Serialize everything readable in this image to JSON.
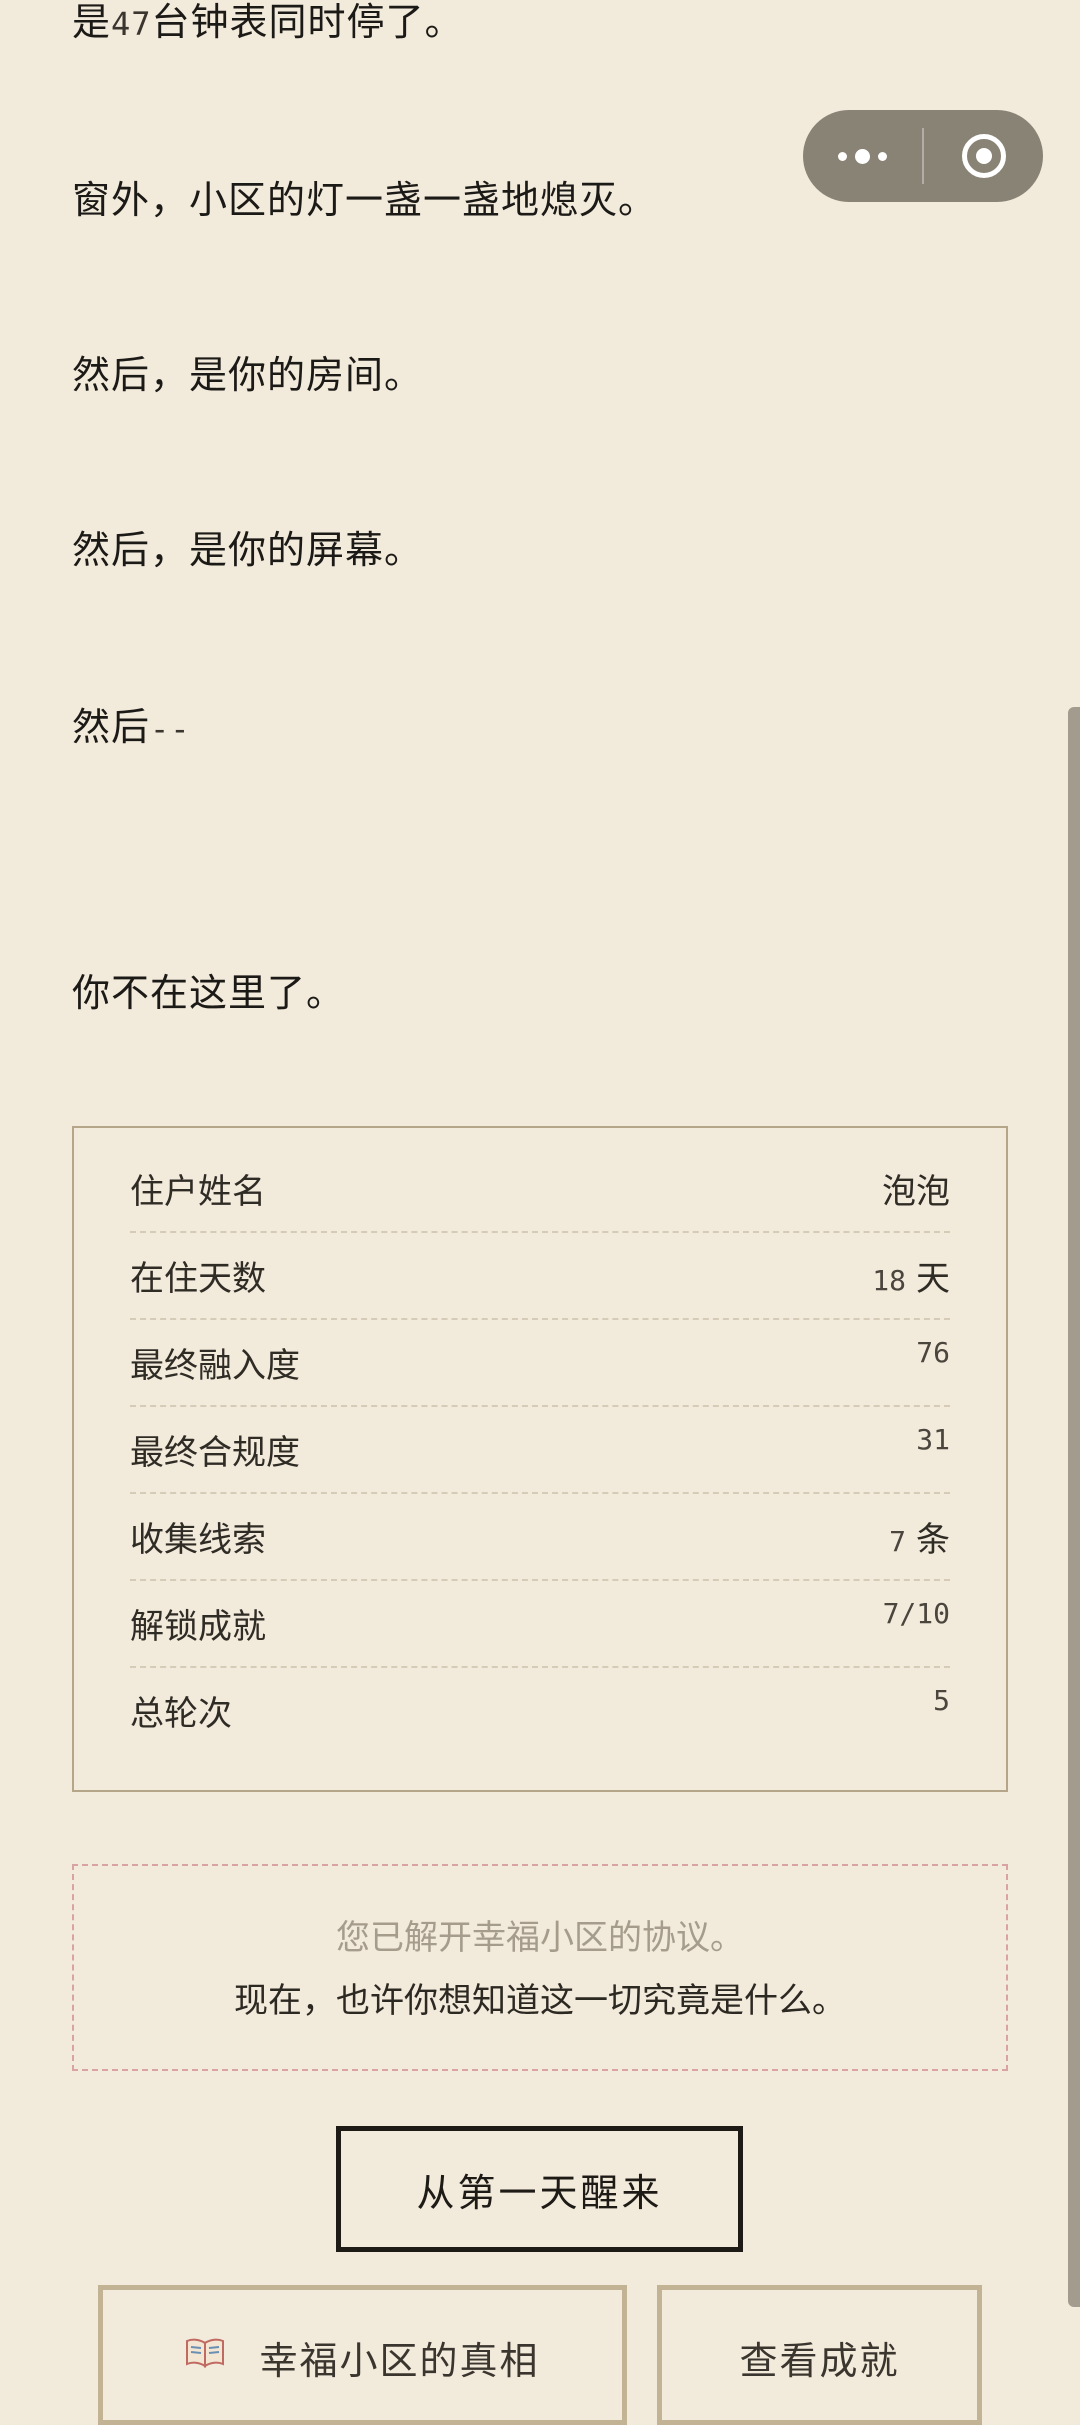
{
  "story": {
    "line1_pre": "是",
    "line1_num": "47",
    "line1_post": "台钟表同时停了。",
    "line2": "窗外，小区的灯一盏一盏地熄灭。",
    "line3": "然后，是你的房间。",
    "line4": "然后，是你的屏幕。",
    "line5_pre": "然后",
    "line5_dash": "--",
    "line6": "你不在这里了。"
  },
  "capsule": {
    "menu_icon": "more-dots-icon",
    "close_icon": "target-circle-icon"
  },
  "stats": [
    {
      "label": "住户姓名",
      "value": "泡泡",
      "unit": ""
    },
    {
      "label": "在住天数",
      "value": "18",
      "unit": "天"
    },
    {
      "label": "最终融入度",
      "value": "76",
      "unit": ""
    },
    {
      "label": "最终合规度",
      "value": "31",
      "unit": ""
    },
    {
      "label": "收集线索",
      "value": "7",
      "unit": "条"
    },
    {
      "label": "解锁成就",
      "value": "7/10",
      "unit": ""
    },
    {
      "label": "总轮次",
      "value": "5",
      "unit": ""
    }
  ],
  "note": {
    "line1": "您已解开幸福小区的协议。",
    "line2": "现在，也许你想知道这一切究竟是什么。"
  },
  "buttons": {
    "restart": "从第一天醒来",
    "truth": "幸福小区的真相",
    "truth_icon": "open-book-icon",
    "achievements": "查看成就"
  },
  "colors": {
    "background": "#f2eadb",
    "card_border": "#b6a689",
    "note_border": "#d9a3a3",
    "capsule": "#807a6c"
  }
}
